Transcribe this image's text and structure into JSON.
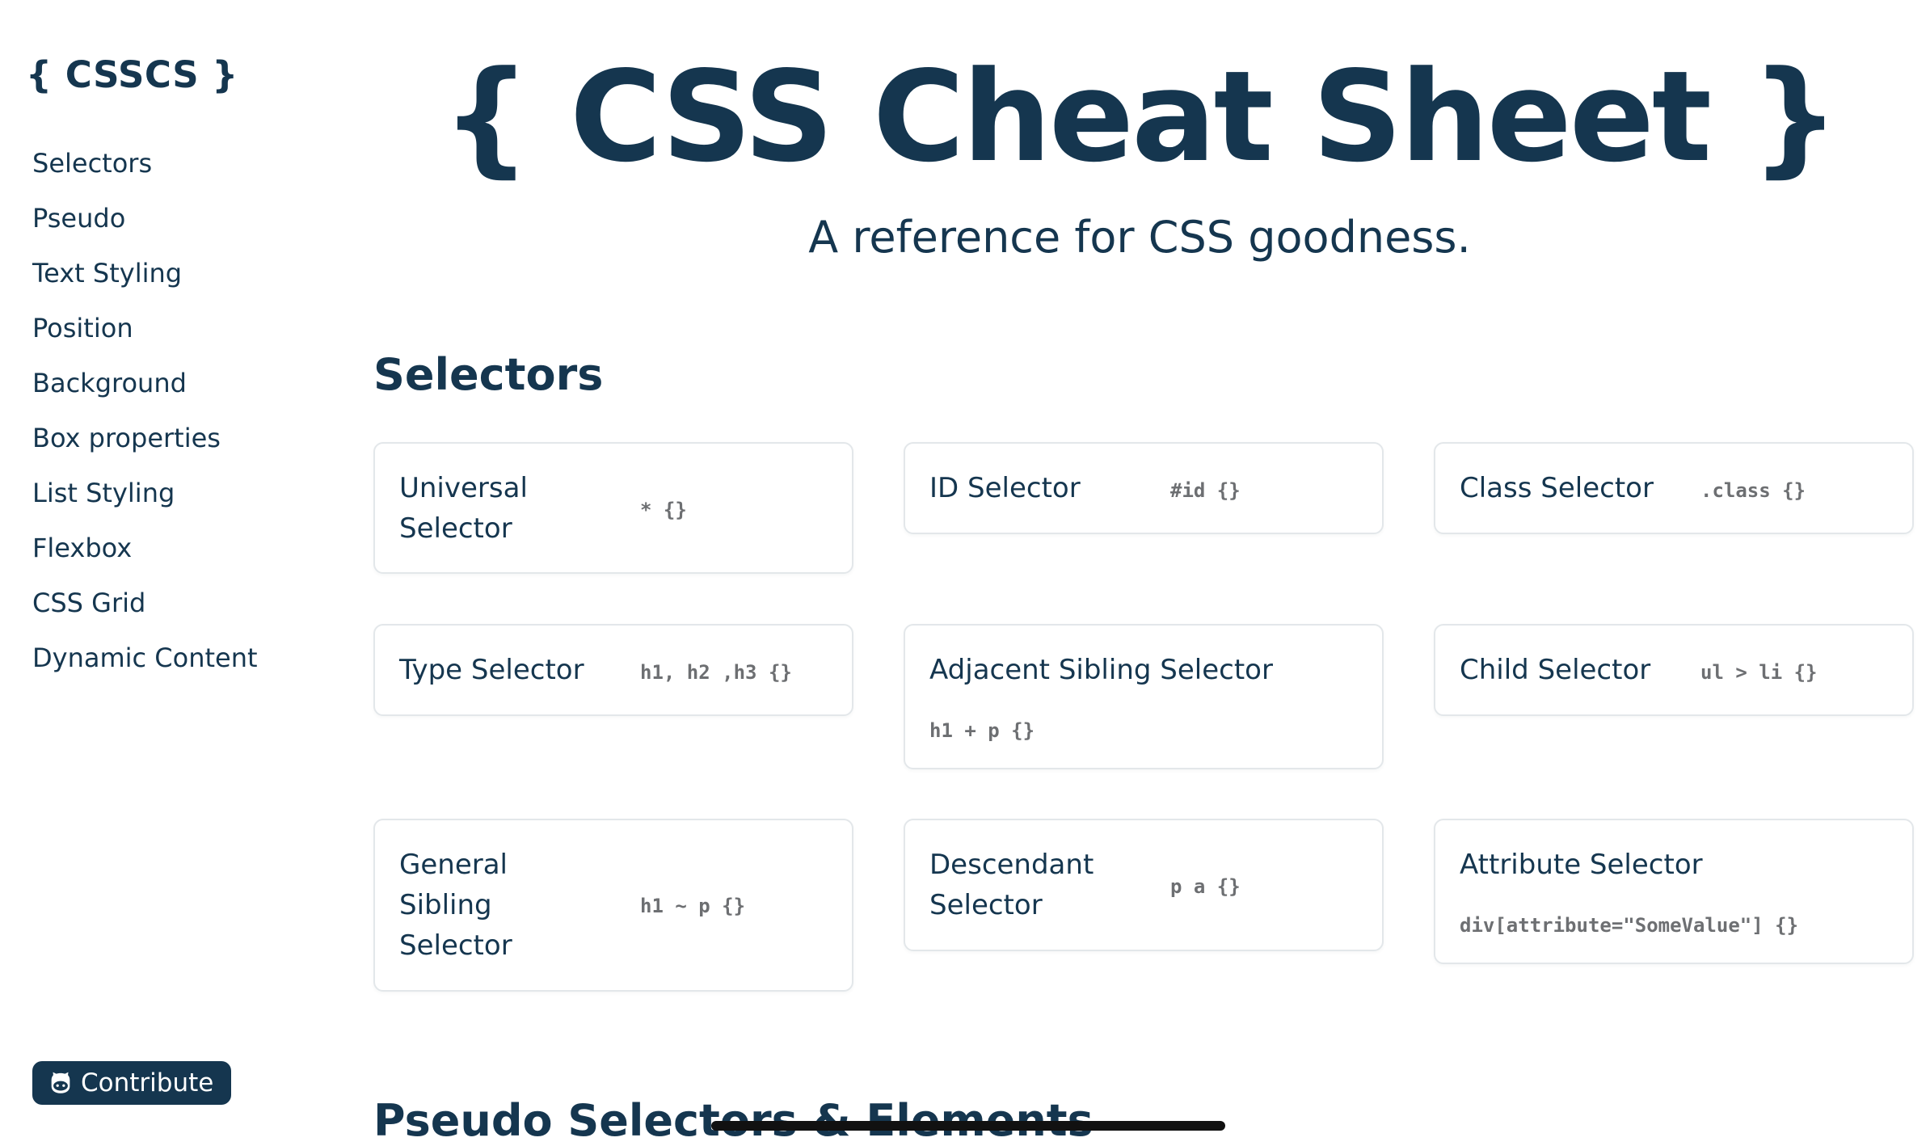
{
  "sidebar": {
    "logo": "{ CSSCS }",
    "items": [
      {
        "label": "Selectors"
      },
      {
        "label": "Pseudo"
      },
      {
        "label": "Text Styling"
      },
      {
        "label": "Position"
      },
      {
        "label": "Background"
      },
      {
        "label": "Box properties"
      },
      {
        "label": "List Styling"
      },
      {
        "label": "Flexbox"
      },
      {
        "label": "CSS Grid"
      },
      {
        "label": "Dynamic Content"
      }
    ],
    "contribute": {
      "label": "Contribute",
      "icon": "github-icon"
    }
  },
  "hero": {
    "title": "{ CSS Cheat Sheet }",
    "subtitle": "A reference for CSS goodness."
  },
  "sections": {
    "selectors": {
      "title": "Selectors",
      "cards": [
        {
          "name": "Universal Selector",
          "code": "* {}"
        },
        {
          "name": "ID Selector",
          "code": "#id {}"
        },
        {
          "name": "Class Selector",
          "code": ".class {}"
        },
        {
          "name": "Type Selector",
          "code": "h1, h2 ,h3 {}"
        },
        {
          "name": "Adjacent Sibling Selector",
          "code": "h1 + p {}"
        },
        {
          "name": "Child Selector",
          "code": "ul > li {}"
        },
        {
          "name": "General Sibling Selector",
          "code": "h1 ~ p {}"
        },
        {
          "name": "Descendant Selector",
          "code": "p a {}"
        },
        {
          "name": "Attribute Selector",
          "code": "div[attribute=\"SomeValue\"] {}"
        }
      ]
    },
    "pseudo": {
      "title": "Pseudo Selectors & Elements"
    }
  },
  "colors": {
    "primary": "#15364f",
    "code": "#6d6f72",
    "card_border": "#e3e7ea",
    "background": "#ffffff"
  }
}
